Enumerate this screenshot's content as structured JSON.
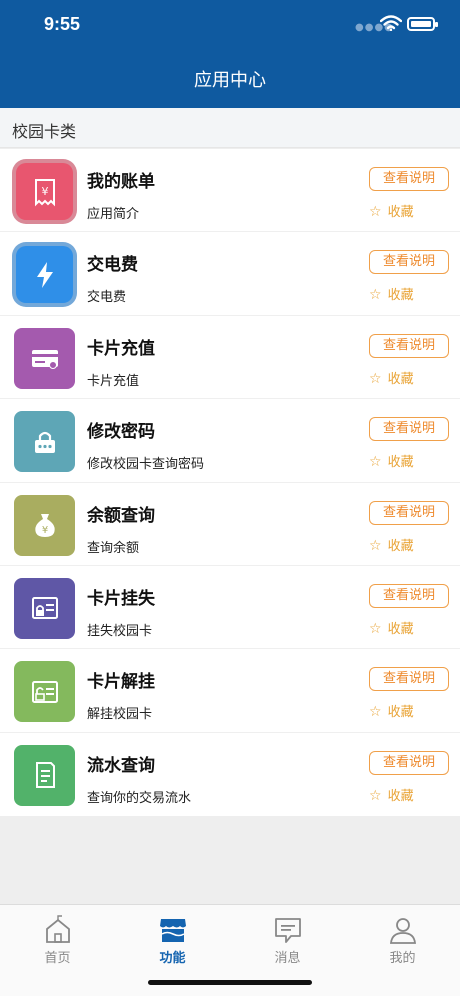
{
  "status_bar": {
    "time": "9:55"
  },
  "header": {
    "title": "应用中心"
  },
  "section": {
    "title": "校园卡类"
  },
  "items": [
    {
      "title": "我的账单",
      "subtitle": "应用简介",
      "button": "查看说明",
      "fav": "收藏",
      "color": "#e8566f",
      "icon": "receipt-yen-icon"
    },
    {
      "title": "交电费",
      "subtitle": "交电费",
      "button": "查看说明",
      "fav": "收藏",
      "color": "#2f8fe8",
      "icon": "lightning-icon"
    },
    {
      "title": "卡片充值",
      "subtitle": "卡片充值",
      "button": "查看说明",
      "fav": "收藏",
      "color": "#a45aae",
      "icon": "card-icon"
    },
    {
      "title": "修改密码",
      "subtitle": "修改校园卡查询密码",
      "button": "查看说明",
      "fav": "收藏",
      "color": "#5ea6b6",
      "icon": "lock-icon"
    },
    {
      "title": "余额查询",
      "subtitle": "查询余额",
      "button": "查看说明",
      "fav": "收藏",
      "color": "#a9ad60",
      "icon": "money-bag-icon"
    },
    {
      "title": "卡片挂失",
      "subtitle": "挂失校园卡",
      "button": "查看说明",
      "fav": "收藏",
      "color": "#5f57a6",
      "icon": "card-lock-icon"
    },
    {
      "title": "卡片解挂",
      "subtitle": "解挂校园卡",
      "button": "查看说明",
      "fav": "收藏",
      "color": "#84b95d",
      "icon": "card-unlock-icon"
    },
    {
      "title": "流水查询",
      "subtitle": "查询你的交易流水",
      "button": "查看说明",
      "fav": "收藏",
      "color": "#52b26a",
      "icon": "document-icon"
    }
  ],
  "tabs": [
    {
      "label": "首页",
      "icon": "home-icon",
      "active": false
    },
    {
      "label": "功能",
      "icon": "store-icon",
      "active": true
    },
    {
      "label": "消息",
      "icon": "message-icon",
      "active": false
    },
    {
      "label": "我的",
      "icon": "person-icon",
      "active": false
    }
  ]
}
